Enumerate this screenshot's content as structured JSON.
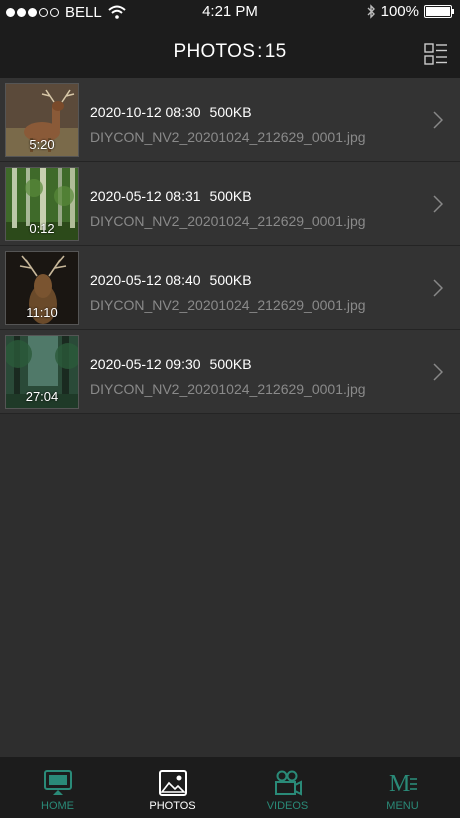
{
  "status_bar": {
    "carrier": "BELL",
    "time": "4:21 PM",
    "battery": "100%",
    "battery_level": 1.0
  },
  "header": {
    "title_prefix": "PHOTOS",
    "title_separator": ":",
    "title_count": "15"
  },
  "photos": [
    {
      "timestamp": "2020-10-12 08:30",
      "size": "500KB",
      "filename": "DIYCON_NV2_20201024_212629_0001.jpg",
      "duration": "5:20"
    },
    {
      "timestamp": "2020-05-12 08:31",
      "size": "500KB",
      "filename": "DIYCON_NV2_20201024_212629_0001.jpg",
      "duration": "0:12"
    },
    {
      "timestamp": "2020-05-12 08:40",
      "size": "500KB",
      "filename": "DIYCON_NV2_20201024_212629_0001.jpg",
      "duration": "11:10"
    },
    {
      "timestamp": "2020-05-12 09:30",
      "size": "500KB",
      "filename": "DIYCON_NV2_20201024_212629_0001.jpg",
      "duration": "27:04"
    }
  ],
  "tabs": [
    {
      "label": "HOME",
      "icon": "home-monitor-icon"
    },
    {
      "label": "PHOTOS",
      "icon": "photos-icon"
    },
    {
      "label": "VIDEOS",
      "icon": "video-camera-icon"
    },
    {
      "label": "MENU",
      "icon": "menu-icon"
    }
  ],
  "colors": {
    "accent": "#2a8a78",
    "background": "#2e2e2e",
    "bar": "#1c1c1c"
  }
}
